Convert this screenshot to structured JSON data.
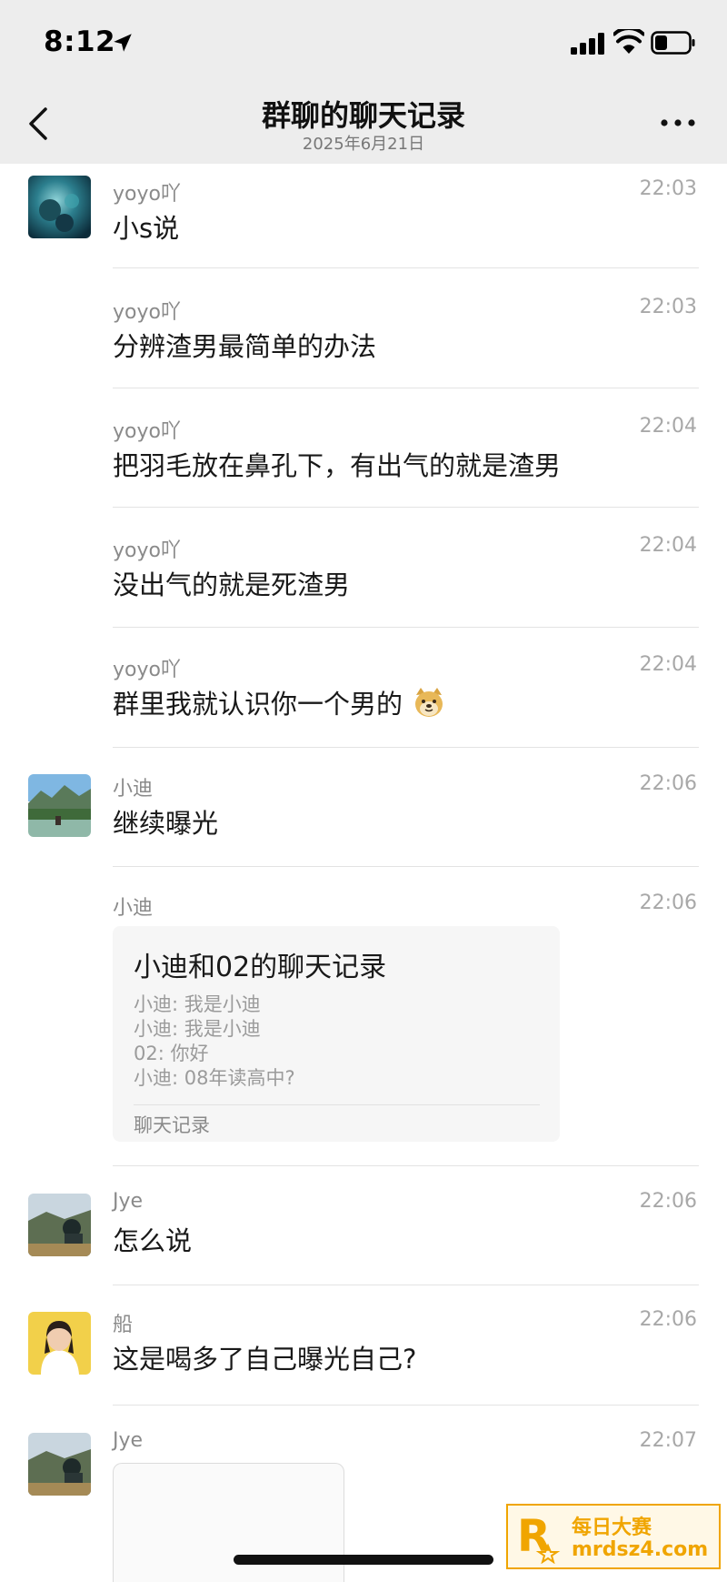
{
  "status_bar": {
    "time": "8:12"
  },
  "nav": {
    "title": "群聊的聊天记录",
    "subtitle": "2025年6月21日"
  },
  "messages": [
    {
      "sender": "yoyo吖",
      "time": "22:03",
      "text": "小s说"
    },
    {
      "sender": "yoyo吖",
      "time": "22:03",
      "text": "分辨渣男最简单的办法"
    },
    {
      "sender": "yoyo吖",
      "time": "22:04",
      "text": "把羽毛放在鼻孔下，有出气的就是渣男"
    },
    {
      "sender": "yoyo吖",
      "time": "22:04",
      "text": "没出气的就是死渣男"
    },
    {
      "sender": "yoyo吖",
      "time": "22:04",
      "text": "群里我就认识你一个男的"
    },
    {
      "sender": "小迪",
      "time": "22:06",
      "text": "继续曝光"
    },
    {
      "sender": "小迪",
      "time": "22:06",
      "card": {
        "title": "小迪和02的聊天记录",
        "lines": [
          "小迪: 我是小迪",
          "小迪: 我是小迪",
          "02: 你好",
          "小迪: 08年读高中?"
        ],
        "footer": "聊天记录"
      }
    },
    {
      "sender": "Jye",
      "time": "22:06",
      "text": "怎么说"
    },
    {
      "sender": "船",
      "time": "22:06",
      "text": "这是喝多了自己曝光自己?"
    },
    {
      "sender": "Jye",
      "time": "22:07"
    }
  ],
  "watermark": {
    "brand": "每日大赛",
    "url": "mrdsz4.com",
    "logo_letter": "R"
  },
  "icons": {
    "location": "location-arrow-icon",
    "signal": "signal-bars-icon",
    "wifi": "wifi-icon",
    "battery": "battery-icon",
    "back": "chevron-left-icon",
    "more": "more-dots-icon",
    "emoji": "doge-emoji-icon"
  }
}
